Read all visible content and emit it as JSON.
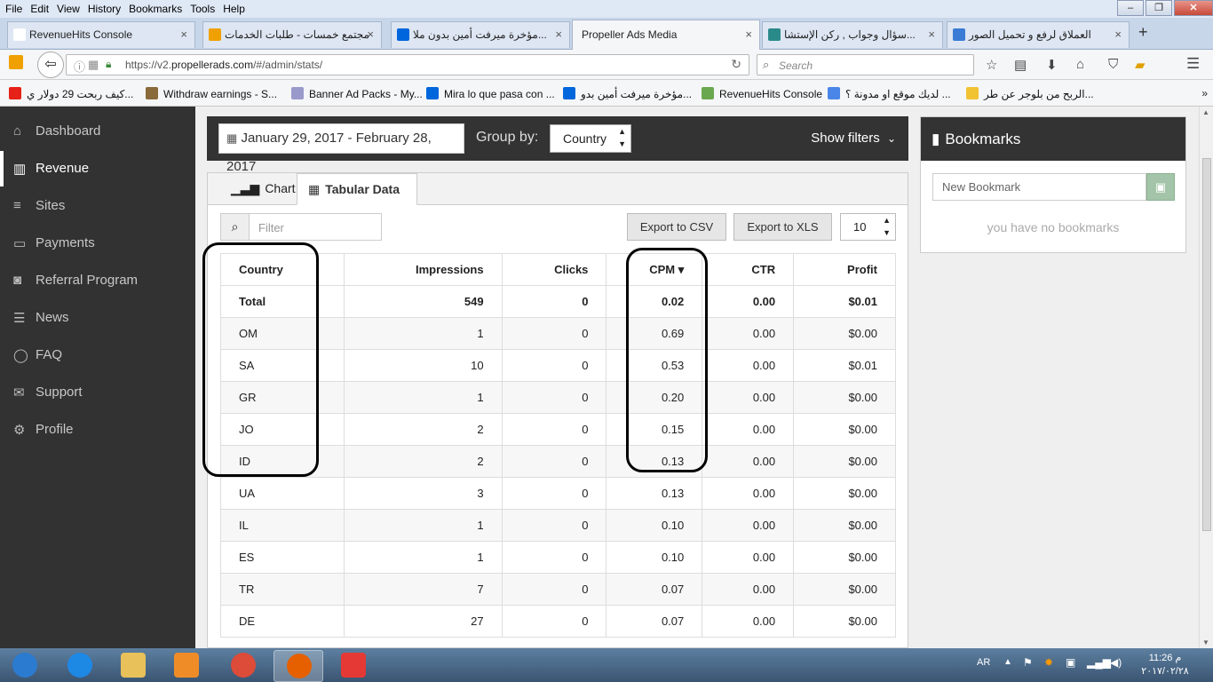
{
  "menubar": [
    "File",
    "Edit",
    "View",
    "History",
    "Bookmarks",
    "Tools",
    "Help"
  ],
  "tabs": [
    {
      "title": "RevenueHits Console",
      "icon": "revenuehits-icon",
      "color": "#ffffff"
    },
    {
      "title": "مجتمع خمسات - طلبات الخدمات",
      "icon": "khamsat-icon",
      "color": "#f0a000"
    },
    {
      "title": "مؤخرة ميرفت أمين بدون ملا...",
      "icon": "dailymotion-icon",
      "color": "#0066dc"
    },
    {
      "title": "Propeller Ads Media",
      "icon": "",
      "color": ""
    },
    {
      "title": "سؤال وجواب , ركن الإستشا...",
      "icon": "site-icon",
      "color": "#2a8a8a"
    },
    {
      "title": "العملاق لرفع و تحميل الصور",
      "icon": "loading-icon",
      "color": "#3a7bd5"
    }
  ],
  "url": {
    "prefix": "https://v2.",
    "domain": "propellerads.com",
    "path": "/#/admin/stats/"
  },
  "search_placeholder": "Search",
  "bookmarks_bar": [
    {
      "label": "كيف ربحت 29 دولار ي...",
      "icon": "youtube-icon",
      "color": "#e62117"
    },
    {
      "label": "Withdraw earnings - S...",
      "icon": "user-icon",
      "color": "#8a6a3a"
    },
    {
      "label": "Banner Ad Packs - My...",
      "icon": "stars-icon",
      "color": "#9999cc"
    },
    {
      "label": "Mira lo que pasa con ...",
      "icon": "dailymotion-icon",
      "color": "#0066dc"
    },
    {
      "label": "مؤخرة ميرفت أمين بدو...",
      "icon": "dailymotion-icon",
      "color": "#0066dc"
    },
    {
      "label": "RevenueHits Console",
      "icon": "revenuehits-icon",
      "color": "#6aa84f"
    },
    {
      "label": "لديك موقع او مدونة ؟ ...",
      "icon": "badge-icon",
      "color": "#4a86e8"
    },
    {
      "label": "الربح من بلوجر عن طر...",
      "icon": "bulb-icon",
      "color": "#f1c232"
    }
  ],
  "sidebar": [
    {
      "label": "Dashboard",
      "icon": "⌂",
      "active": false
    },
    {
      "label": "Revenue",
      "icon": "▥",
      "active": true
    },
    {
      "label": "Sites",
      "icon": "≡",
      "active": false
    },
    {
      "label": "Payments",
      "icon": "▭",
      "active": false
    },
    {
      "label": "Referral Program",
      "icon": "◙",
      "active": false
    },
    {
      "label": "News",
      "icon": "☰",
      "active": false
    },
    {
      "label": "FAQ",
      "icon": "◯",
      "active": false
    },
    {
      "label": "Support",
      "icon": "✉",
      "active": false
    },
    {
      "label": "Profile",
      "icon": "⚙",
      "active": false
    }
  ],
  "toolbar": {
    "date_range": "January 29, 2017 - February 28, 2017",
    "group_by_label": "Group by:",
    "group_by_value": "Country",
    "show_filters": "Show filters"
  },
  "bookmarks_panel": {
    "title": "Bookmarks",
    "input_placeholder": "New Bookmark",
    "empty_text": "you have no bookmarks"
  },
  "view_tabs": [
    {
      "label": "Chart",
      "active": false
    },
    {
      "label": "Tabular Data",
      "active": true
    }
  ],
  "filter_placeholder": "Filter",
  "export_csv": "Export to CSV",
  "export_xls": "Export to XLS",
  "page_size": "10",
  "table": {
    "columns": [
      "Country",
      "Impressions",
      "Clicks",
      "CPM",
      "CTR",
      "Profit"
    ],
    "sort_column": "CPM",
    "total": [
      "Total",
      "549",
      "0",
      "0.02",
      "0.00",
      "$0.01"
    ],
    "rows": [
      [
        "OM",
        "1",
        "0",
        "0.69",
        "0.00",
        "$0.00"
      ],
      [
        "SA",
        "10",
        "0",
        "0.53",
        "0.00",
        "$0.01"
      ],
      [
        "GR",
        "1",
        "0",
        "0.20",
        "0.00",
        "$0.00"
      ],
      [
        "JO",
        "2",
        "0",
        "0.15",
        "0.00",
        "$0.00"
      ],
      [
        "ID",
        "2",
        "0",
        "0.13",
        "0.00",
        "$0.00"
      ],
      [
        "UA",
        "3",
        "0",
        "0.13",
        "0.00",
        "$0.00"
      ],
      [
        "IL",
        "1",
        "0",
        "0.10",
        "0.00",
        "$0.00"
      ],
      [
        "ES",
        "1",
        "0",
        "0.10",
        "0.00",
        "$0.00"
      ],
      [
        "TR",
        "7",
        "0",
        "0.07",
        "0.00",
        "$0.00"
      ],
      [
        "DE",
        "27",
        "0",
        "0.07",
        "0.00",
        "$0.00"
      ]
    ]
  },
  "taskbar": {
    "language": "AR",
    "time": "11:26 م",
    "date": "٢٠١٧/٠٢/٢٨",
    "apps": [
      {
        "name": "start-orb",
        "color": "#2b7bd1"
      },
      {
        "name": "internet-explorer",
        "color": "#1e88e5"
      },
      {
        "name": "file-explorer",
        "color": "#e8c15a"
      },
      {
        "name": "media-player",
        "color": "#f08c28"
      },
      {
        "name": "chrome",
        "color": "#dd4b39"
      },
      {
        "name": "firefox",
        "color": "#e66000"
      },
      {
        "name": "upload-app",
        "color": "#e53935"
      }
    ]
  }
}
